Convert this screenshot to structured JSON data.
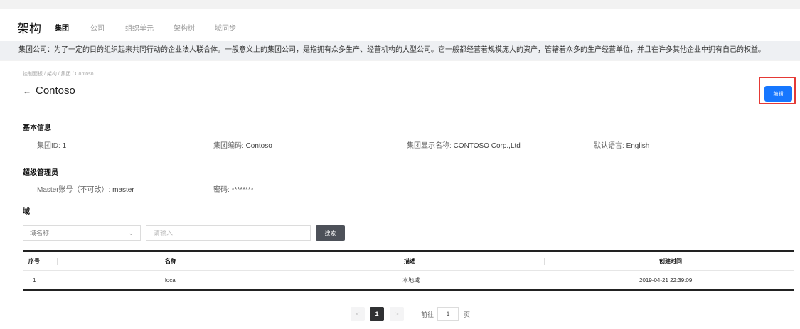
{
  "topnav": {
    "brand": "架构",
    "tabs": [
      {
        "label": "集团",
        "active": true
      },
      {
        "label": "公司",
        "active": false
      },
      {
        "label": "组织单元",
        "active": false
      },
      {
        "label": "架构树",
        "active": false
      },
      {
        "label": "域同步",
        "active": false
      }
    ]
  },
  "notice": "集团公司：为了一定的目的组织起来共同行动的企业法人联合体。一般意义上的集团公司，是指拥有众多生产、经营机构的大型公司。它一般都经营着规模庞大的资产，管辖着众多的生产经营单位，并且在许多其他企业中拥有自己的权益。",
  "breadcrumb": "控制面板 / 架构 / 集团 / Contoso",
  "title": "Contoso",
  "back_icon": "arrow-left-icon",
  "edit_label": "编辑",
  "basic": {
    "heading": "基本信息",
    "fields": [
      {
        "key": "集团ID:",
        "value": "1"
      },
      {
        "key": "集团编码:",
        "value": "Contoso"
      },
      {
        "key": "集团显示名称:",
        "value": "CONTOSO Corp.,Ltd"
      },
      {
        "key": "默认语言:",
        "value": "English"
      }
    ]
  },
  "admin": {
    "heading": "超级管理员",
    "fields": [
      {
        "key": "Master账号（不可改）:",
        "value": "master"
      },
      {
        "key": "密码:",
        "value": "********"
      }
    ]
  },
  "domain": {
    "heading": "域",
    "select_value": "域名称",
    "input_placeholder": "请输入",
    "search_label": "搜索"
  },
  "table": {
    "columns": [
      "序号",
      "名称",
      "描述",
      "创建时间"
    ],
    "rows": [
      [
        "1",
        "local",
        "本地域",
        "2019-04-21 22:39:09"
      ]
    ]
  },
  "pager": {
    "prev": "<",
    "current": "1",
    "next": ">",
    "goto_label": "前往",
    "goto_value": "1",
    "page_unit": "页"
  },
  "colors": {
    "accent": "#1677ff",
    "highlight": "#e53935"
  }
}
